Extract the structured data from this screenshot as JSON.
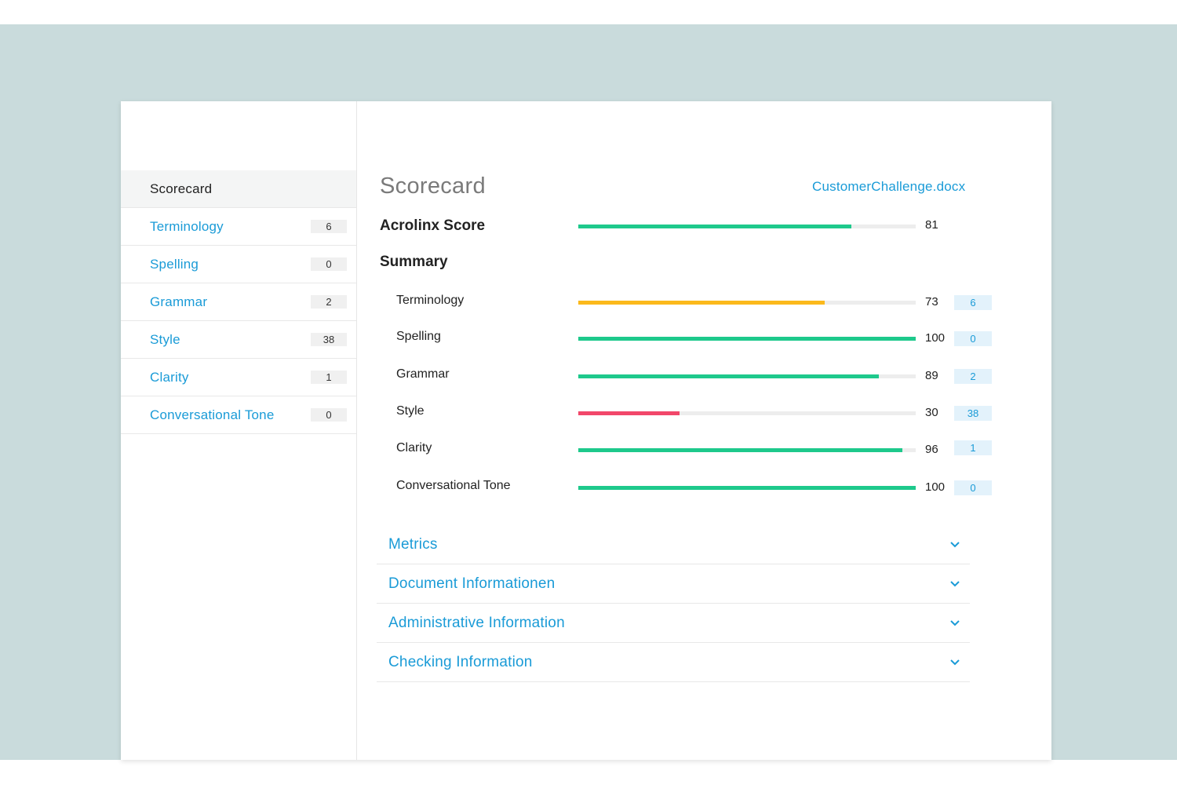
{
  "sidebar": {
    "items": [
      {
        "label": "Scorecard",
        "count": ""
      },
      {
        "label": "Terminology",
        "count": "6"
      },
      {
        "label": "Spelling",
        "count": "0"
      },
      {
        "label": "Grammar",
        "count": "2"
      },
      {
        "label": "Style",
        "count": "38"
      },
      {
        "label": "Clarity",
        "count": "1"
      },
      {
        "label": "Conversational Tone",
        "count": "0"
      }
    ]
  },
  "main": {
    "title": "Scorecard",
    "file_link": "CustomerChallenge.docx",
    "acrolinx": {
      "label": "Acrolinx Score",
      "value": "81",
      "color": "#1ec98c"
    },
    "summary_label": "Summary",
    "summary": [
      {
        "label": "Terminology",
        "value": "73",
        "issues": "6",
        "color": "#fbb91c"
      },
      {
        "label": "Spelling",
        "value": "100",
        "issues": "0",
        "color": "#1ec98c"
      },
      {
        "label": "Grammar",
        "value": "89",
        "issues": "2",
        "color": "#1ec98c"
      },
      {
        "label": "Style",
        "value": "30",
        "issues": "38",
        "color": "#f2476a"
      },
      {
        "label": "Clarity",
        "value": "96",
        "issues": "1",
        "color": "#1ec98c"
      },
      {
        "label": "Conversational Tone",
        "value": "100",
        "issues": "0",
        "color": "#1ec98c"
      }
    ],
    "sections": [
      {
        "label": "Metrics",
        "icon": "chevron-down-icon"
      },
      {
        "label": "Document Informationen",
        "icon": "chevron-down-icon"
      },
      {
        "label": "Administrative Information",
        "icon": "chevron-down-icon"
      },
      {
        "label": "Checking Information",
        "icon": "chevron-down-icon"
      }
    ]
  },
  "colors": {
    "accent": "#1a9bd7",
    "good": "#1ec98c",
    "warn": "#fbb91c",
    "bad": "#f2476a",
    "backdrop": "#c9dbdc"
  }
}
